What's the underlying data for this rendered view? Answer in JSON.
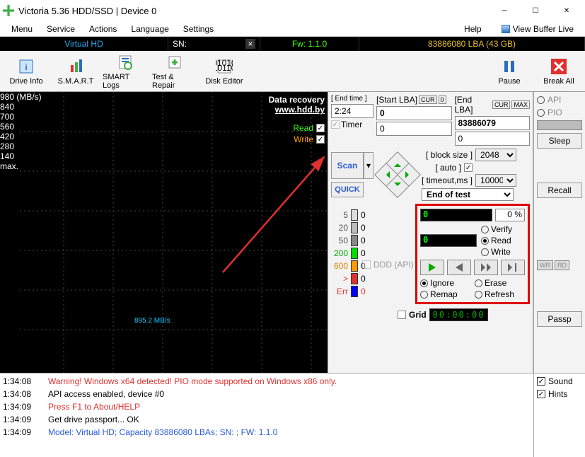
{
  "window": {
    "title": "Victoria 5.36 HDD/SSD | Device 0"
  },
  "menu": {
    "items": [
      "Menu",
      "Service",
      "Actions",
      "Language",
      "Settings"
    ],
    "help": "Help",
    "viewBuffer": "View Buffer Live"
  },
  "status": {
    "model": "Virtual HD",
    "snLabel": "SN:",
    "sn": "",
    "fw": "Fw: 1.1.0",
    "lba": "83886080 LBA (43 GB)"
  },
  "toolbar": {
    "driveInfo": "Drive Info",
    "smart": "S.M.A.R.T",
    "smartLogs": "SMART Logs",
    "testRepair": "Test & Repair",
    "diskEditor": "Disk Editor",
    "pause": "Pause",
    "breakAll": "Break All"
  },
  "graph": {
    "ylabel": "980 (MB/s)",
    "yticks": [
      "840",
      "700",
      "560",
      "420",
      "280",
      "140"
    ],
    "recovery1": "Data recovery",
    "recovery2": "www.hdd.by",
    "read": "Read",
    "write": "Write",
    "speed": "895.2 MB/s",
    "max": "max."
  },
  "lba": {
    "endTimeHdr": "[ End time ]",
    "startHdr": "[Start LBA]",
    "endHdr": "[End LBA]",
    "cur": "CUR",
    "max": "MAX",
    "zero": "0",
    "timerLabel": "Timer",
    "endTime": "2:24",
    "startVal": "0",
    "endVal": "83886079",
    "startCur": "0",
    "endCur": "0"
  },
  "scan": {
    "scan": "Scan",
    "quick": "QUICK",
    "blockSize": "[ block size ]",
    "auto": "[ auto ]",
    "timeout": "[ timeout,ms ]",
    "bsVal": "2048",
    "toVal": "10000",
    "endOfTest": "End of test"
  },
  "hist": {
    "b5": "5",
    "b20": "20",
    "b50": "50",
    "b200": "200",
    "b600": "600",
    "gt": ">",
    "err": "Err",
    "zero": "0"
  },
  "ddd": {
    "label": "DDD (API)"
  },
  "redbox": {
    "prog1": "0",
    "pct": "0",
    "pctSym": "%",
    "prog2": "0",
    "verify": "Verify",
    "read": "Read",
    "write": "Write",
    "ignore": "Ignore",
    "erase": "Erase",
    "remap": "Remap",
    "refresh": "Refresh"
  },
  "grid": {
    "label": "Grid",
    "time": "00:00:00"
  },
  "right": {
    "api": "API",
    "pio": "PIO",
    "sleep": "Sleep",
    "recall": "Recall",
    "wr": "WR",
    "rd": "RD",
    "passp": "Passp"
  },
  "log": {
    "lines": [
      {
        "ts": "1:34:08",
        "cls": "red",
        "msg": "Warning! Windows x64 detected! PIO mode supported on Windows x86 only."
      },
      {
        "ts": "1:34:08",
        "cls": "",
        "msg": "API access enabled, device #0"
      },
      {
        "ts": "1:34:09",
        "cls": "red",
        "msg": "Press F1 to About/HELP"
      },
      {
        "ts": "1:34:09",
        "cls": "",
        "msg": "Get drive passport... OK"
      },
      {
        "ts": "1:34:09",
        "cls": "blue",
        "msg": "Model: Virtual HD; Capacity 83886080 LBAs; SN: ; FW: 1.1.0"
      }
    ],
    "sound": "Sound",
    "hints": "Hints"
  }
}
